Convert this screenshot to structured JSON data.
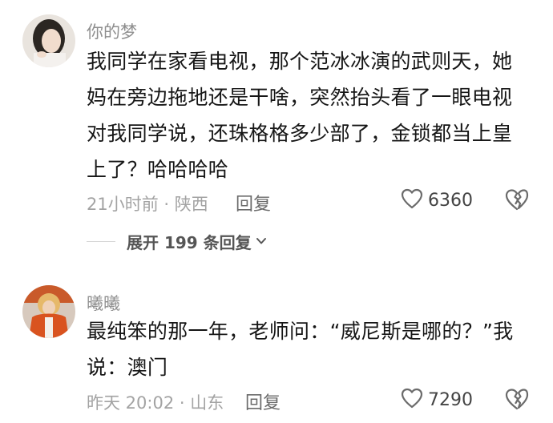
{
  "comments": [
    {
      "username": "你的梦",
      "lines": [
        "我同学在家看电视，那个范冰冰演的武则天，她",
        "妈在旁边拖地还是干啥，突然抬头看了一眼电视",
        "对我同学说，还珠格格多少部了，金锁都当上皇",
        "上了？哈哈哈哈"
      ],
      "meta": "21小时前 · 陕西",
      "reply_label": "回复",
      "likes": "6360",
      "expand_label": "展开 199 条回复"
    },
    {
      "username": "曦曦",
      "lines": [
        "最纯笨的那一年，老师问：“威尼斯是哪的？”我",
        "说：澳门"
      ],
      "meta": "昨天 20:02 · 山东",
      "reply_label": "回复",
      "likes": "7290"
    }
  ],
  "icons": {
    "like": "heart-outline-icon",
    "dislike": "broken-heart-icon",
    "expand": "chevron-down-icon"
  },
  "colors": {
    "text": "#161616",
    "username": "#8e8e8e",
    "meta": "#a3a3a3",
    "icon": "#6b6b6b"
  }
}
